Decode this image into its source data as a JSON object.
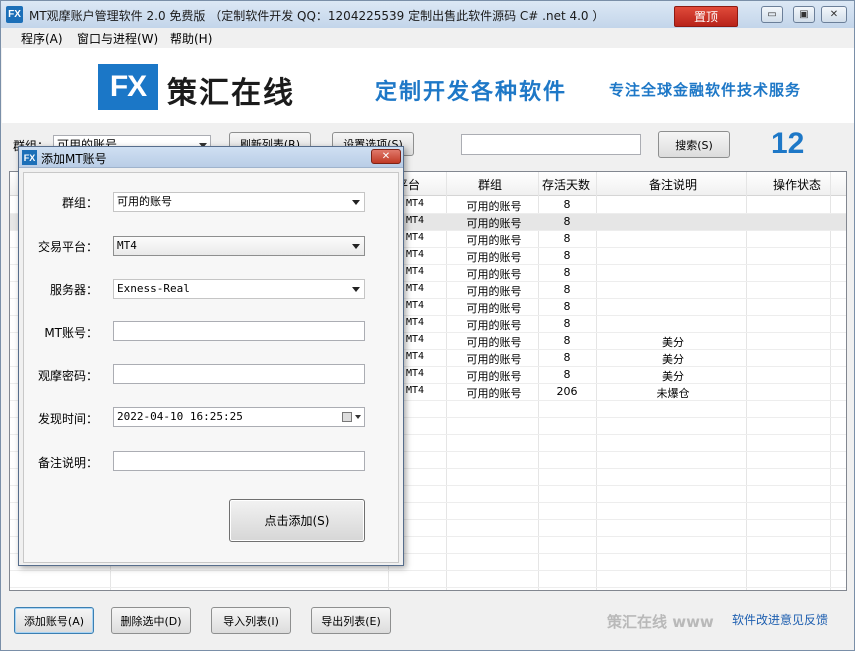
{
  "window": {
    "title": "MT观摩账户管理软件 2.0 免费版 （定制软件开发 QQ：1204225539   定制出售此软件源码 C# .net 4.0 ）",
    "pin_label": "置顶",
    "minimize_glyph": "▭",
    "restore_glyph": "▣",
    "close_glyph": "✕",
    "icon_text": "FX"
  },
  "menu": [
    "程序(A)",
    "窗口与进程(W)",
    "帮助(H)"
  ],
  "banner": {
    "logo_mark": "FX",
    "logo_text": "策汇在线",
    "slogan_main": "定制开发各种软件",
    "slogan_sub": "专注全球金融软件技术服务"
  },
  "toolbar": {
    "group_label": "群组：",
    "group_value": "可用的账号",
    "refresh_label": "刷新列表(R)",
    "settings_label": "设置选项(S)",
    "search_value": "",
    "search_label": "搜索(S)",
    "count": "12"
  },
  "table": {
    "columns": [
      "平台",
      "群组",
      "存活天数",
      "备注说明",
      "操作状态"
    ],
    "rows": [
      {
        "platform": "MT4",
        "group": "可用的账号",
        "days": "8",
        "note": "",
        "status": ""
      },
      {
        "platform": "MT4",
        "group": "可用的账号",
        "days": "8",
        "note": "",
        "status": ""
      },
      {
        "platform": "MT4",
        "group": "可用的账号",
        "days": "8",
        "note": "",
        "status": ""
      },
      {
        "platform": "MT4",
        "group": "可用的账号",
        "days": "8",
        "note": "",
        "status": ""
      },
      {
        "platform": "MT4",
        "group": "可用的账号",
        "days": "8",
        "note": "",
        "status": ""
      },
      {
        "platform": "MT4",
        "group": "可用的账号",
        "days": "8",
        "note": "",
        "status": ""
      },
      {
        "platform": "MT4",
        "group": "可用的账号",
        "days": "8",
        "note": "",
        "status": ""
      },
      {
        "platform": "MT4",
        "group": "可用的账号",
        "days": "8",
        "note": "",
        "status": ""
      },
      {
        "platform": "MT4",
        "group": "可用的账号",
        "days": "8",
        "note": "美分",
        "status": ""
      },
      {
        "platform": "MT4",
        "group": "可用的账号",
        "days": "8",
        "note": "美分",
        "status": ""
      },
      {
        "platform": "MT4",
        "group": "可用的账号",
        "days": "8",
        "note": "美分",
        "status": ""
      },
      {
        "platform": "MT4",
        "group": "可用的账号",
        "days": "206",
        "note": "未爆仓",
        "status": ""
      }
    ]
  },
  "bottom": {
    "add_label": "添加账号(A)",
    "delete_label": "删除选中(D)",
    "import_label": "导入列表(I)",
    "export_label": "导出列表(E)",
    "brand": "策汇在线 www",
    "feedback": "软件改进意见反馈"
  },
  "dialog": {
    "title": "添加MT账号",
    "icon_text": "FX",
    "close_glyph": "✕",
    "fields": {
      "group_label": "群组：",
      "group_value": "可用的账号",
      "platform_label": "交易平台：",
      "platform_value": "MT4",
      "server_label": "服务器：",
      "server_value": "Exness-Real",
      "account_label": "MT账号：",
      "account_value": "",
      "password_label": "观摩密码：",
      "password_value": "",
      "time_label": "发现时间：",
      "time_value": "2022-04-10 16:25:25",
      "note_label": "备注说明：",
      "note_value": ""
    },
    "submit_label": "点击添加(S)"
  },
  "colors": {
    "brand_blue": "#1e78c7",
    "pin_red": "#c8261b"
  }
}
